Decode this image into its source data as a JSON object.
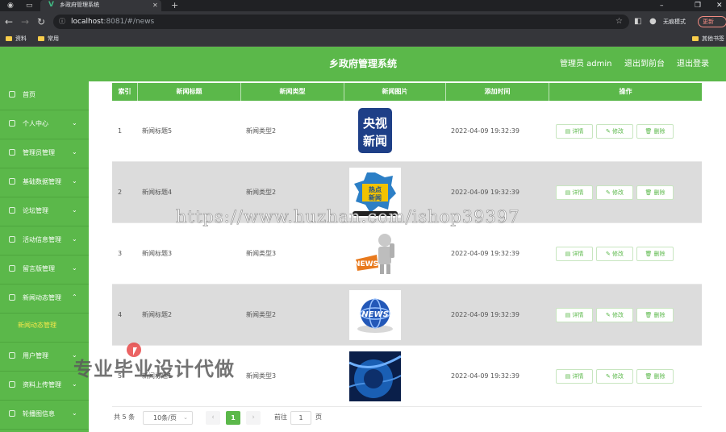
{
  "browser": {
    "tab_title": "乡政府管理系统",
    "url_host": "localhost",
    "url_rest": ":8081/#/news",
    "incognito_label": "无痕模式",
    "update_label": "更新",
    "bookmarks": [
      "资料",
      "常用"
    ],
    "other_bookmarks": "其他书签"
  },
  "header": {
    "title": "乡政府管理系统",
    "user": "管理员 admin",
    "back_front": "退出到前台",
    "logout": "退出登录"
  },
  "sidebar": {
    "items": [
      {
        "label": "首页",
        "arrow": ""
      },
      {
        "label": "个人中心",
        "arrow": "⌄"
      },
      {
        "label": "管理员管理",
        "arrow": "⌄"
      },
      {
        "label": "基础数据管理",
        "arrow": "⌄"
      },
      {
        "label": "论坛管理",
        "arrow": "⌄"
      },
      {
        "label": "活动信息管理",
        "arrow": "⌄"
      },
      {
        "label": "留言版管理",
        "arrow": "⌄"
      },
      {
        "label": "新闻动态管理",
        "arrow": "⌃"
      }
    ],
    "active_sub": "新闻动态管理",
    "items_after": [
      {
        "label": "用户管理",
        "arrow": "⌄"
      },
      {
        "label": "资料上传管理",
        "arrow": "⌄"
      },
      {
        "label": "轮播图信息",
        "arrow": "⌄"
      }
    ]
  },
  "table": {
    "headers": [
      "索引",
      "新闻标题",
      "新闻类型",
      "新闻图片",
      "添加时间",
      "操作"
    ],
    "rows": [
      {
        "index": "1",
        "title": "新闻标题5",
        "type": "新闻类型2",
        "time": "2022-04-09 19:32:39",
        "image": "cctv-news-icon"
      },
      {
        "index": "2",
        "title": "新闻标题4",
        "type": "新闻类型2",
        "time": "2022-04-09 19:32:39",
        "image": "hot-news-icon"
      },
      {
        "index": "3",
        "title": "新闻标题3",
        "type": "新闻类型3",
        "time": "2022-04-09 19:32:39",
        "image": "news-figure-icon"
      },
      {
        "index": "4",
        "title": "新闻标题2",
        "type": "新闻类型2",
        "time": "2022-04-09 19:32:39",
        "image": "globe-news-icon"
      },
      {
        "index": "5",
        "title": "新闻标题1",
        "type": "新闻类型3",
        "time": "2022-04-09 19:32:39",
        "image": "blue-tech-icon"
      }
    ],
    "actions": {
      "detail": "详情",
      "edit": "修改",
      "delete": "删除"
    }
  },
  "pager": {
    "total": "共 5 条",
    "page_size": "10条/页",
    "current": "1",
    "goto_label": "前往",
    "goto_value": "1",
    "page_unit": "页"
  },
  "overlays": {
    "watermark_url": "https://www.huzhan.com/ishop39397",
    "watermark_ad": "专业毕业设计代做"
  },
  "colors": {
    "brand_green": "#5bb84a",
    "active_sub": "#f5e94a",
    "alt_row": "#dcdcdc"
  }
}
